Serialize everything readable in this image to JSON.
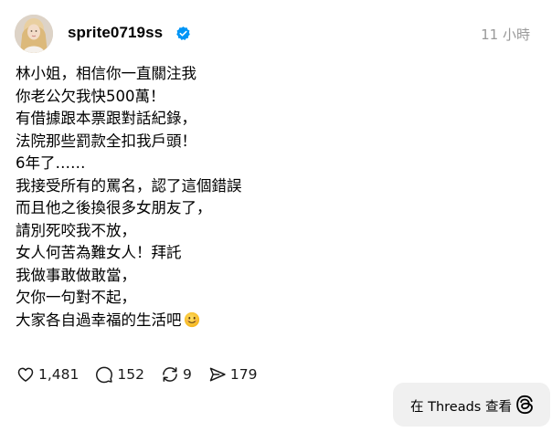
{
  "post": {
    "username": "sprite0719ss",
    "verified": true,
    "timestamp": "11 小時",
    "lines": [
      "林小姐，相信你一直關注我",
      "你老公欠我快500萬！",
      "有借據跟本票跟對話紀錄，",
      "法院那些罰款全扣我戶頭！",
      "6年了……",
      "我接受所有的罵名，認了這個錯誤",
      "而且他之後換很多女朋友了，",
      "請別死咬我不放，",
      "女人何苦為難女人！拜託",
      "我做事敢做敢當，",
      "欠你一句對不起，",
      "大家各自過幸福的生活吧"
    ],
    "last_line_emoji": "slightly-smiling-face-emoji"
  },
  "actions": {
    "likes": "1,481",
    "replies": "152",
    "reposts": "9",
    "shares": "179"
  },
  "view_button": {
    "label": "在 Threads 查看",
    "icon": "threads-logo-icon"
  },
  "colors": {
    "verified_blue": "#0095f6",
    "timestamp_gray": "#999999",
    "button_bg": "#f0f0f0"
  }
}
